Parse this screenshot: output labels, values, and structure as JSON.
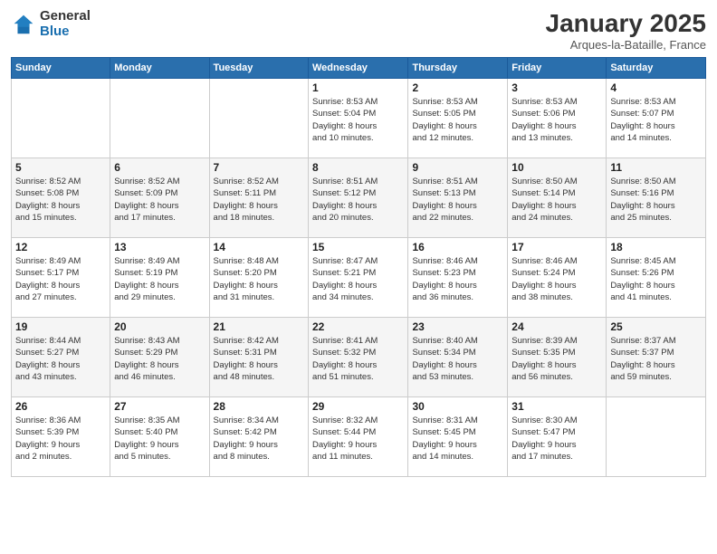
{
  "logo": {
    "general": "General",
    "blue": "Blue"
  },
  "title": "January 2025",
  "subtitle": "Arques-la-Bataille, France",
  "days_of_week": [
    "Sunday",
    "Monday",
    "Tuesday",
    "Wednesday",
    "Thursday",
    "Friday",
    "Saturday"
  ],
  "weeks": [
    [
      {
        "day": "",
        "info": ""
      },
      {
        "day": "",
        "info": ""
      },
      {
        "day": "",
        "info": ""
      },
      {
        "day": "1",
        "info": "Sunrise: 8:53 AM\nSunset: 5:04 PM\nDaylight: 8 hours\nand 10 minutes."
      },
      {
        "day": "2",
        "info": "Sunrise: 8:53 AM\nSunset: 5:05 PM\nDaylight: 8 hours\nand 12 minutes."
      },
      {
        "day": "3",
        "info": "Sunrise: 8:53 AM\nSunset: 5:06 PM\nDaylight: 8 hours\nand 13 minutes."
      },
      {
        "day": "4",
        "info": "Sunrise: 8:53 AM\nSunset: 5:07 PM\nDaylight: 8 hours\nand 14 minutes."
      }
    ],
    [
      {
        "day": "5",
        "info": "Sunrise: 8:52 AM\nSunset: 5:08 PM\nDaylight: 8 hours\nand 15 minutes."
      },
      {
        "day": "6",
        "info": "Sunrise: 8:52 AM\nSunset: 5:09 PM\nDaylight: 8 hours\nand 17 minutes."
      },
      {
        "day": "7",
        "info": "Sunrise: 8:52 AM\nSunset: 5:11 PM\nDaylight: 8 hours\nand 18 minutes."
      },
      {
        "day": "8",
        "info": "Sunrise: 8:51 AM\nSunset: 5:12 PM\nDaylight: 8 hours\nand 20 minutes."
      },
      {
        "day": "9",
        "info": "Sunrise: 8:51 AM\nSunset: 5:13 PM\nDaylight: 8 hours\nand 22 minutes."
      },
      {
        "day": "10",
        "info": "Sunrise: 8:50 AM\nSunset: 5:14 PM\nDaylight: 8 hours\nand 24 minutes."
      },
      {
        "day": "11",
        "info": "Sunrise: 8:50 AM\nSunset: 5:16 PM\nDaylight: 8 hours\nand 25 minutes."
      }
    ],
    [
      {
        "day": "12",
        "info": "Sunrise: 8:49 AM\nSunset: 5:17 PM\nDaylight: 8 hours\nand 27 minutes."
      },
      {
        "day": "13",
        "info": "Sunrise: 8:49 AM\nSunset: 5:19 PM\nDaylight: 8 hours\nand 29 minutes."
      },
      {
        "day": "14",
        "info": "Sunrise: 8:48 AM\nSunset: 5:20 PM\nDaylight: 8 hours\nand 31 minutes."
      },
      {
        "day": "15",
        "info": "Sunrise: 8:47 AM\nSunset: 5:21 PM\nDaylight: 8 hours\nand 34 minutes."
      },
      {
        "day": "16",
        "info": "Sunrise: 8:46 AM\nSunset: 5:23 PM\nDaylight: 8 hours\nand 36 minutes."
      },
      {
        "day": "17",
        "info": "Sunrise: 8:46 AM\nSunset: 5:24 PM\nDaylight: 8 hours\nand 38 minutes."
      },
      {
        "day": "18",
        "info": "Sunrise: 8:45 AM\nSunset: 5:26 PM\nDaylight: 8 hours\nand 41 minutes."
      }
    ],
    [
      {
        "day": "19",
        "info": "Sunrise: 8:44 AM\nSunset: 5:27 PM\nDaylight: 8 hours\nand 43 minutes."
      },
      {
        "day": "20",
        "info": "Sunrise: 8:43 AM\nSunset: 5:29 PM\nDaylight: 8 hours\nand 46 minutes."
      },
      {
        "day": "21",
        "info": "Sunrise: 8:42 AM\nSunset: 5:31 PM\nDaylight: 8 hours\nand 48 minutes."
      },
      {
        "day": "22",
        "info": "Sunrise: 8:41 AM\nSunset: 5:32 PM\nDaylight: 8 hours\nand 51 minutes."
      },
      {
        "day": "23",
        "info": "Sunrise: 8:40 AM\nSunset: 5:34 PM\nDaylight: 8 hours\nand 53 minutes."
      },
      {
        "day": "24",
        "info": "Sunrise: 8:39 AM\nSunset: 5:35 PM\nDaylight: 8 hours\nand 56 minutes."
      },
      {
        "day": "25",
        "info": "Sunrise: 8:37 AM\nSunset: 5:37 PM\nDaylight: 8 hours\nand 59 minutes."
      }
    ],
    [
      {
        "day": "26",
        "info": "Sunrise: 8:36 AM\nSunset: 5:39 PM\nDaylight: 9 hours\nand 2 minutes."
      },
      {
        "day": "27",
        "info": "Sunrise: 8:35 AM\nSunset: 5:40 PM\nDaylight: 9 hours\nand 5 minutes."
      },
      {
        "day": "28",
        "info": "Sunrise: 8:34 AM\nSunset: 5:42 PM\nDaylight: 9 hours\nand 8 minutes."
      },
      {
        "day": "29",
        "info": "Sunrise: 8:32 AM\nSunset: 5:44 PM\nDaylight: 9 hours\nand 11 minutes."
      },
      {
        "day": "30",
        "info": "Sunrise: 8:31 AM\nSunset: 5:45 PM\nDaylight: 9 hours\nand 14 minutes."
      },
      {
        "day": "31",
        "info": "Sunrise: 8:30 AM\nSunset: 5:47 PM\nDaylight: 9 hours\nand 17 minutes."
      },
      {
        "day": "",
        "info": ""
      }
    ]
  ]
}
